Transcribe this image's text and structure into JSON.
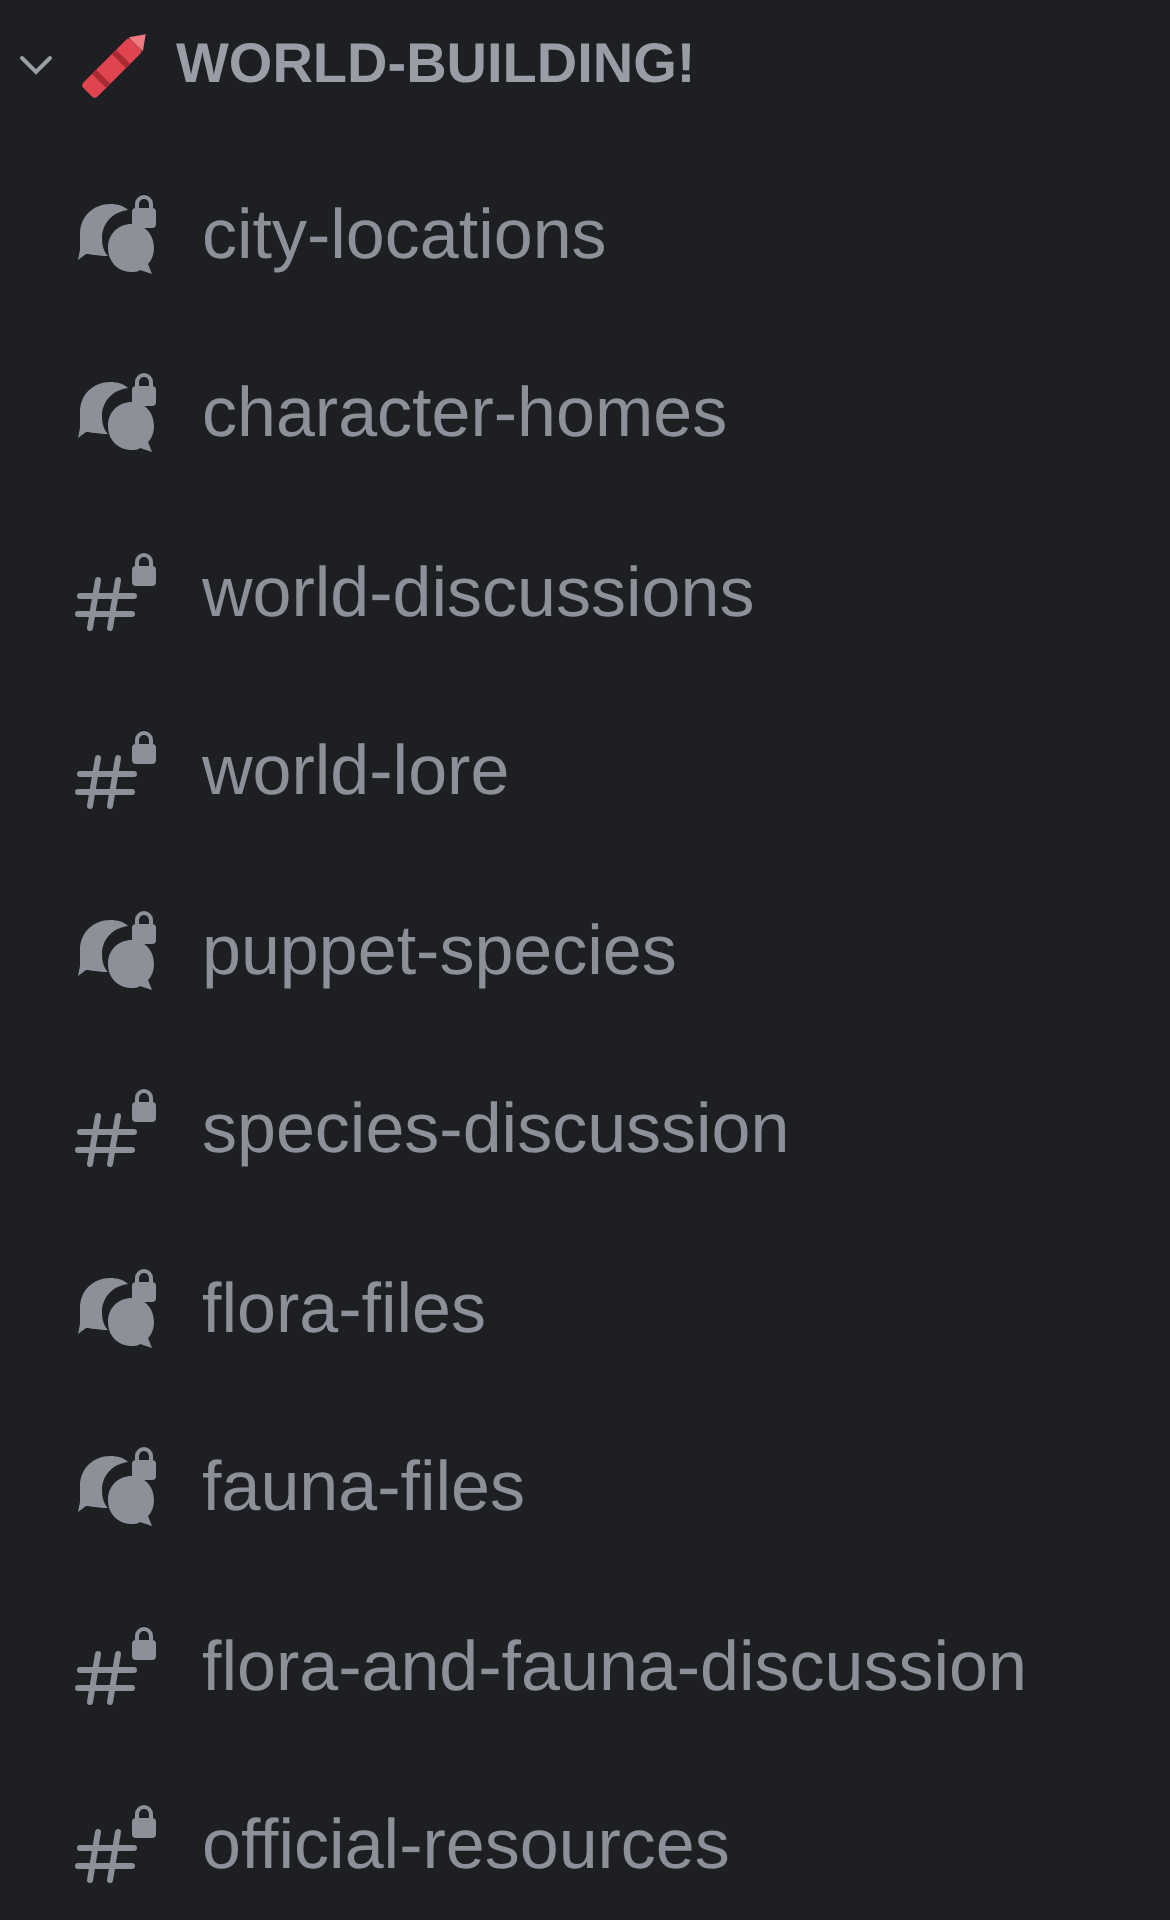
{
  "category": {
    "title": "WORLD-BUILDING!",
    "expanded": true
  },
  "channels": [
    {
      "name": "city-locations",
      "kind": "forum"
    },
    {
      "name": "character-homes",
      "kind": "forum"
    },
    {
      "name": "world-discussions",
      "kind": "text"
    },
    {
      "name": "world-lore",
      "kind": "text"
    },
    {
      "name": "puppet-species",
      "kind": "forum"
    },
    {
      "name": "species-discussion",
      "kind": "text"
    },
    {
      "name": "flora-files",
      "kind": "forum"
    },
    {
      "name": "fauna-files",
      "kind": "forum"
    },
    {
      "name": "flora-and-fauna-discussion",
      "kind": "text"
    },
    {
      "name": "official-resources",
      "kind": "text"
    }
  ]
}
